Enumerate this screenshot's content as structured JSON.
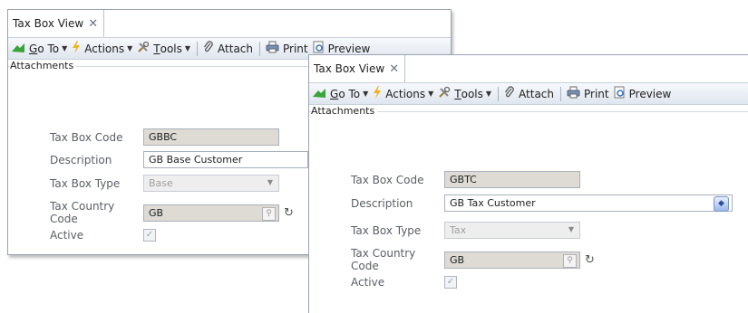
{
  "windows": [
    {
      "tab_title": "Tax Box View",
      "close_glyph": "✕",
      "toolbar": {
        "goto_prefix": "G",
        "goto_rest": "o To",
        "actions": "Actions",
        "tools_prefix": "T",
        "tools_rest": "ools",
        "attach": "Attach",
        "print": "Print",
        "preview": "Preview"
      },
      "group_label": "Attachments",
      "fields": {
        "code_label": "Tax Box Code",
        "code_value": "GBBC",
        "desc_label": "Description",
        "desc_value": "GB Base Customer",
        "type_label": "Tax Box Type",
        "type_value": "Base",
        "country_label": "Tax Country Code",
        "country_value": "GB",
        "active_label": "Active"
      }
    },
    {
      "tab_title": "Tax Box View",
      "close_glyph": "✕",
      "toolbar": {
        "goto_prefix": "G",
        "goto_rest": "o To",
        "actions": "Actions",
        "tools_prefix": "T",
        "tools_rest": "ools",
        "attach": "Attach",
        "print": "Print",
        "preview": "Preview"
      },
      "group_label": "Attachments",
      "fields": {
        "code_label": "Tax Box Code",
        "code_value": "GBTC",
        "desc_label": "Description",
        "desc_value": "GB Tax Customer",
        "type_label": "Tax Box Type",
        "type_value": "Tax",
        "country_label": "Tax Country Code",
        "country_value": "GB",
        "active_label": "Active"
      }
    }
  ],
  "icons": {
    "goto": "goto-arrow-icon",
    "actions": "lightning-icon",
    "tools": "tools-icon",
    "attach": "paperclip-icon",
    "print": "printer-icon",
    "preview": "preview-icon"
  }
}
